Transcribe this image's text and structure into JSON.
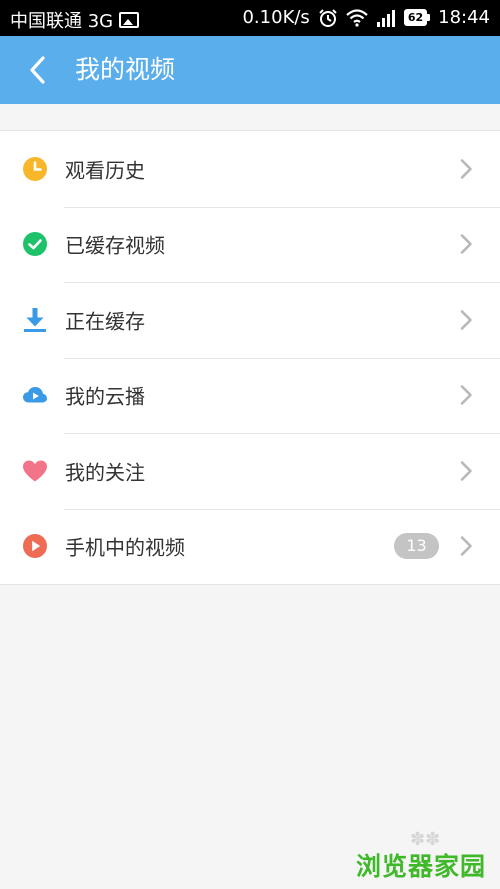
{
  "status_bar": {
    "carrier": "中国联通 3G",
    "speed": "0.10K/s",
    "battery": "62",
    "time": "18:44"
  },
  "header": {
    "title": "我的视频"
  },
  "menu": {
    "items": [
      {
        "label": "观看历史",
        "icon": "clock-icon",
        "color": "#f8b62a"
      },
      {
        "label": "已缓存视频",
        "icon": "check-icon",
        "color": "#1ec26a"
      },
      {
        "label": "正在缓存",
        "icon": "download-icon",
        "color": "#3a9ae5"
      },
      {
        "label": "我的云播",
        "icon": "cloud-play-icon",
        "color": "#3a9ae5"
      },
      {
        "label": "我的关注",
        "icon": "heart-icon",
        "color": "#f27489"
      },
      {
        "label": "手机中的视频",
        "icon": "play-icon",
        "color": "#ee6c54",
        "badge": "13"
      }
    ]
  },
  "watermark": {
    "text": "浏览器家园"
  }
}
